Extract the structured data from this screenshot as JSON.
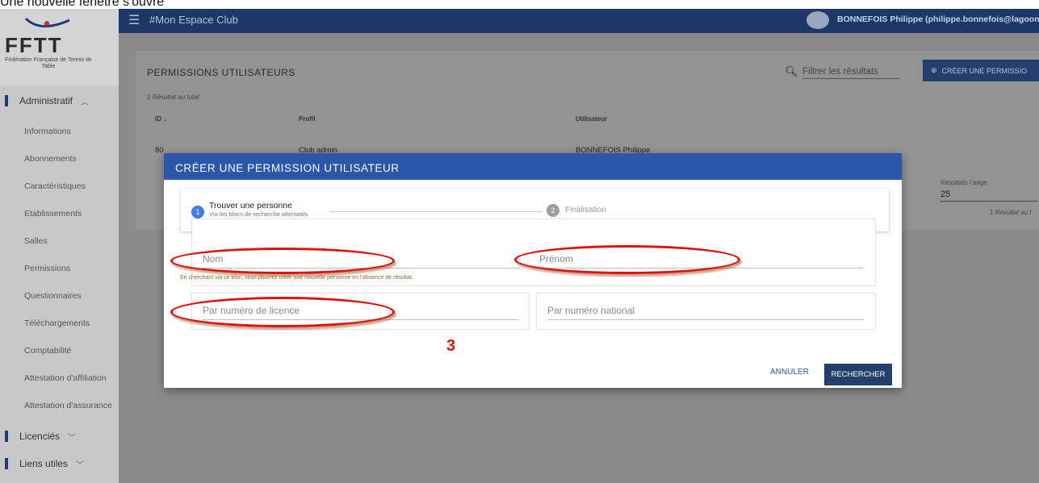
{
  "caption": "Une nouvelle fenêtre s'ouvre",
  "topbar": {
    "title": "#Mon Espace Club",
    "user": "BONNEFOIS Philippe (philippe.bonnefois@lagoon"
  },
  "logo": {
    "text": "FFTT",
    "subtitle": "Fédération Française de Tennis de Table"
  },
  "sidebar": {
    "section_admin": "Administratif",
    "items": [
      "Informations",
      "Abonnements",
      "Caractéristiques",
      "Etablissements",
      "Salles",
      "Permissions",
      "Questionnaires",
      "Téléchargements",
      "Comptabilité",
      "Attestation d'affiliation",
      "Attestation d'assurance"
    ],
    "section_licencies": "Licenciés",
    "section_liens": "Liens utiles"
  },
  "card": {
    "title": "PERMISSIONS UTILISATEURS",
    "filter_placeholder": "Filtrer les résultats",
    "create_label": "CRÉER UNE PERMISSIO",
    "total": "1 Résultat au total",
    "columns": [
      "ID ↓",
      "Profil",
      "Utilisateur"
    ],
    "row": [
      "80",
      "Club admin",
      "BONNEFOIS Philippe"
    ],
    "results_per_page_label": "Résultats / page",
    "results_per_page": "25",
    "results_total": "1 Résultat au t"
  },
  "modal": {
    "title": "CRÉER UNE PERMISSION UTILISATEUR",
    "step1_num": "1",
    "step1_label": "Trouver une personne",
    "step1_sub": "Via les blocs de recherche alternatifs",
    "step2_num": "2",
    "step2_label": "Finalisation",
    "nom_placeholder": "Nom",
    "prenom_placeholder": "Prénom",
    "hint": "En cherchant via ce bloc, vous pourrez créer une nouvelle personne en l'absence de résultat.",
    "licence_placeholder": "Par numéro de licence",
    "national_placeholder": "Par numéro national",
    "cancel_label": "ANNULER",
    "search_label": "RECHERCHER"
  },
  "annotation_number": "3"
}
